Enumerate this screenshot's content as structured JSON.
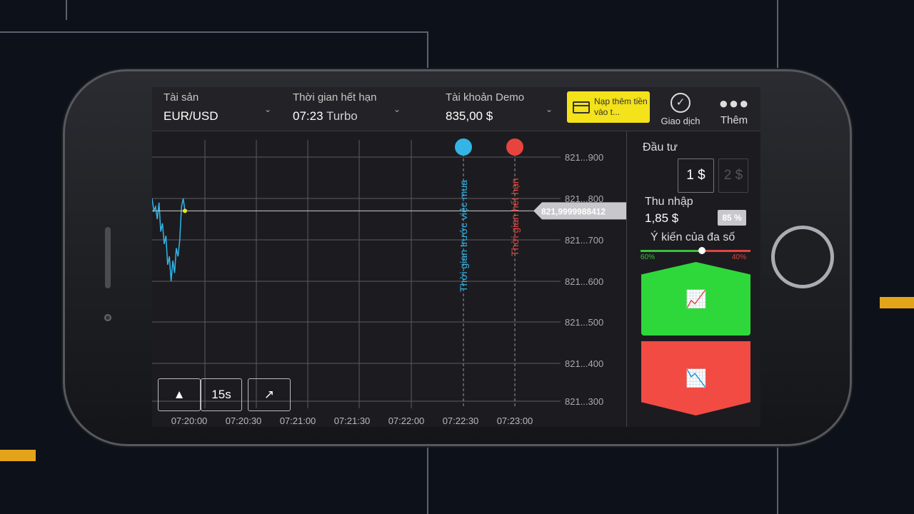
{
  "header": {
    "asset_label": "Tài sản",
    "asset_value": "EUR/USD",
    "expiry_label": "Thời gian hết hạn",
    "expiry_time": "07:23",
    "expiry_mode": "Turbo",
    "account_label": "Tài khoản Demo",
    "account_balance": "835,00 $",
    "deposit_label": "Nạp thêm tiền vào t...",
    "trade_label": "Giao dịch",
    "more_label": "Thêm"
  },
  "chart_data": {
    "type": "line",
    "x_ticks": [
      "07:20:00",
      "07:20:30",
      "07:21:00",
      "07:21:30",
      "07:22:00",
      "07:22:30",
      "07:23:00"
    ],
    "y_ticks": [
      "821...900",
      "821...800",
      "821...700",
      "821...600",
      "821...500",
      "821...400",
      "821...300"
    ],
    "ylim": [
      821.27,
      821.97
    ],
    "series": [
      {
        "values": [
          821.8,
          821.77,
          821.78,
          821.75,
          821.79,
          821.72,
          821.74,
          821.69,
          821.71,
          821.64,
          821.66,
          821.6,
          821.65,
          821.62,
          821.68,
          821.66,
          821.7,
          821.78,
          821.8,
          821.77
        ]
      }
    ],
    "current_price_label": "821,9999988412",
    "current_price_level": 821.77,
    "purchase_line_label": "Thời gian trước việc mua",
    "expiry_line_label": "Thời gian hết hạn",
    "colors": {
      "line": "#33b5e8",
      "purchase": "#35b4e6",
      "expiry": "#e8443e"
    }
  },
  "chart_controls": {
    "interval": "15s"
  },
  "panel": {
    "invest_label": "Đầu tư",
    "amount_1": "1 $",
    "amount_2": "2 $",
    "income_label": "Thu nhập",
    "income_value": "1,85 $",
    "payout": "85 %",
    "sentiment_label": "Ý kiến của đa số",
    "sentiment_up": "60%",
    "sentiment_down": "40%",
    "colors": {
      "up": "#2fd83a",
      "down": "#f14b43"
    }
  }
}
